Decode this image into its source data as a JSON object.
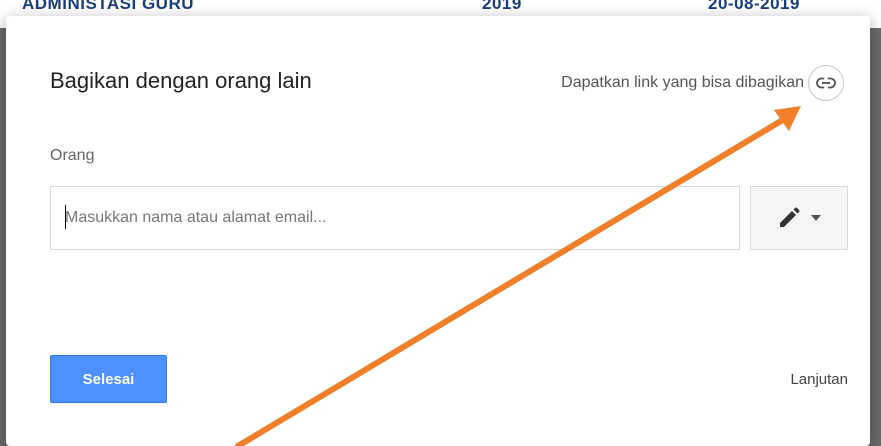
{
  "background": {
    "heading_text": "ADMINISTASI GURU",
    "col2_text": "2019",
    "col3_text": "20-08-2019"
  },
  "dialog": {
    "title": "Bagikan dengan orang lain",
    "share_link_label": "Dapatkan link yang bisa dibagikan",
    "people_label": "Orang",
    "email_input": {
      "placeholder": "Masukkan nama atau alamat email...",
      "value": ""
    },
    "permission_icon": "pencil-icon",
    "done_label": "Selesai",
    "advanced_label": "Lanjutan"
  },
  "annotation": {
    "arrow_color": "#f07f2a"
  },
  "colors": {
    "primary_button": "#4d90fe",
    "title_text": "#222222"
  }
}
